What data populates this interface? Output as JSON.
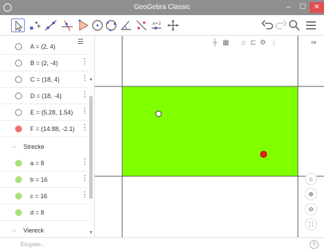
{
  "window": {
    "title": "GeoGebra Classic",
    "minimize": "–",
    "maximize": "☐",
    "close": "✕"
  },
  "toolbar": {
    "tools": [
      "move-tool",
      "point-tool",
      "line-tool",
      "perpendicular-line-tool",
      "polygon-tool",
      "circle-tool",
      "circle-through-points-tool",
      "angle-tool",
      "reflect-tool",
      "slider-tool",
      "move-graphics-view-tool"
    ],
    "selected": "move-tool"
  },
  "algebra": {
    "items_points": [
      {
        "expr": "A = (2, 4)",
        "color": "hollow"
      },
      {
        "expr": "B = (2, -4)",
        "color": "hollow"
      },
      {
        "expr": "C = (18, 4)",
        "color": "hollow"
      },
      {
        "expr": "D = (18, -4)",
        "color": "hollow"
      },
      {
        "expr": "E = (5.28, 1.54)",
        "color": "hollow"
      },
      {
        "expr": "F = (14.88, -2.1)",
        "color": "red"
      }
    ],
    "group_strecke": "Strecke",
    "items_segments": [
      {
        "expr": "a = 8"
      },
      {
        "expr": "b = 16"
      },
      {
        "expr": "c = 16"
      },
      {
        "expr": "d = 8"
      }
    ],
    "group_viereck": "Viereck",
    "menu_glyph": "☰"
  },
  "graphics": {
    "rect_color": "#80ff00",
    "point_E_color": "#ffffff",
    "point_F_color": "#e02020"
  },
  "inputbar": {
    "placeholder": "Eingabe..."
  }
}
